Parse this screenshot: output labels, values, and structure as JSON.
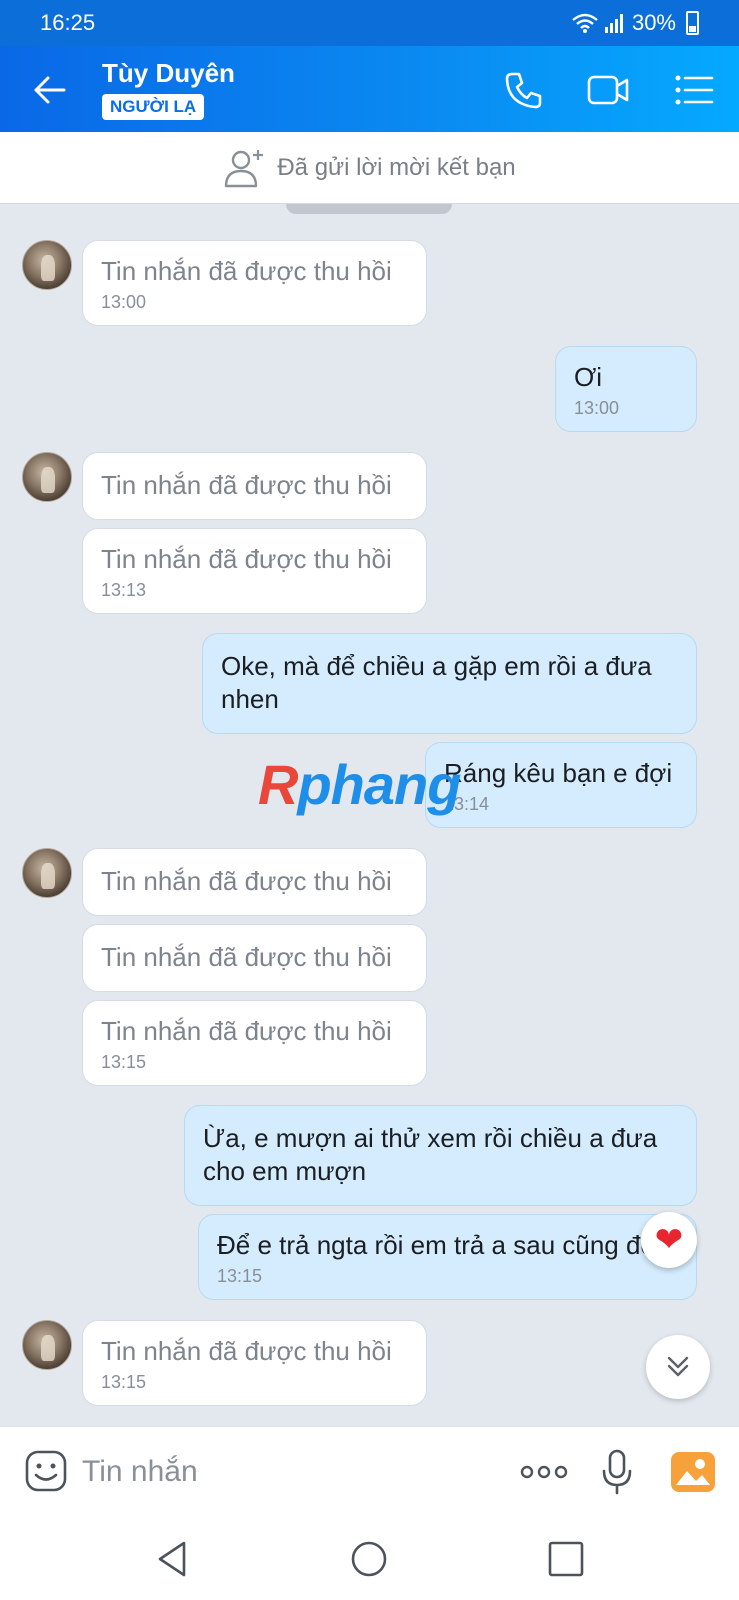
{
  "status_bar": {
    "time": "16:25",
    "battery": "30%"
  },
  "header": {
    "contact_name": "Tùy Duyên",
    "badge": "NGƯỜI LẠ"
  },
  "friend_bar": {
    "text": "Đã gửi lời mời kết bạn"
  },
  "messages": [
    {
      "dir": "in",
      "text": "Tin nhắn đã được thu hồi",
      "time": "13:00"
    },
    {
      "dir": "out",
      "text": "Ơi",
      "time": "13:00"
    },
    {
      "dir": "in",
      "text": "Tin nhắn đã được thu hồi",
      "time": ""
    },
    {
      "dir": "in",
      "text": "Tin nhắn đã được thu hồi",
      "time": "13:13"
    },
    {
      "dir": "out",
      "text": "Oke, mà để chiều a gặp em rồi a đưa nhen",
      "time": ""
    },
    {
      "dir": "out",
      "text": "Ráng kêu bạn e đợi",
      "time": "13:14"
    },
    {
      "dir": "in",
      "text": "Tin nhắn đã được thu hồi",
      "time": ""
    },
    {
      "dir": "in",
      "text": "Tin nhắn đã được thu hồi",
      "time": ""
    },
    {
      "dir": "in",
      "text": "Tin nhắn đã được thu hồi",
      "time": "13:15"
    },
    {
      "dir": "out",
      "text": "Ừa, e mượn ai thử xem rồi chiều a đưa cho em mượn",
      "time": ""
    },
    {
      "dir": "out",
      "text": "Để e trả ngta rồi em trả a sau cũng đc",
      "time": "13:15"
    },
    {
      "dir": "in",
      "text": "Tin nhắn đã được thu hồi",
      "time": "13:15"
    }
  ],
  "watermark": {
    "part1": "R",
    "part2": "phang"
  },
  "input_bar": {
    "placeholder": "Tin nhắn"
  },
  "icons": {
    "back": "arrow-left-icon",
    "call": "phone-icon",
    "video": "video-camera-icon",
    "menu": "list-menu-icon",
    "add_friend": "add-user-icon",
    "emoji": "emoji-icon",
    "more": "more-dots-icon",
    "mic": "microphone-icon",
    "gallery": "image-gallery-icon",
    "reaction": "heart-icon",
    "scroll": "chevron-double-down-icon"
  },
  "colors": {
    "header": "#0a8cf2",
    "out_bubble": "#d4ecfd",
    "in_bubble": "#ffffff",
    "background": "#e3e8ef"
  }
}
